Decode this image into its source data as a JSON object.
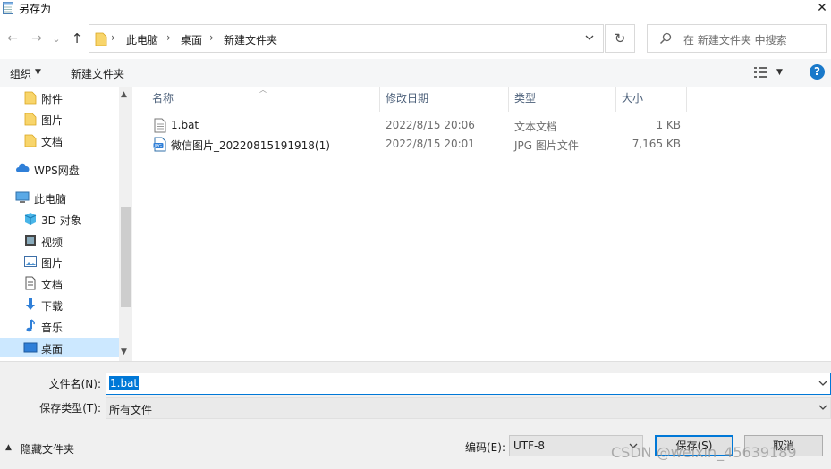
{
  "window": {
    "title": "另存为",
    "close_glyph": "✕"
  },
  "nav": {
    "back_glyph": "←",
    "forward_glyph": "→",
    "recent_glyph": "⌄",
    "up_glyph": "↑",
    "breadcrumbs": [
      "此电脑",
      "桌面",
      "新建文件夹"
    ],
    "crumb_separator": "›",
    "refresh_glyph": "↻",
    "search_placeholder": "在 新建文件夹 中搜索"
  },
  "toolbar": {
    "organize_label": "组织",
    "new_folder_label": "新建文件夹",
    "help_glyph": "?"
  },
  "sidebar": {
    "items": [
      {
        "label": "附件",
        "icon": "folder-icon"
      },
      {
        "label": "图片",
        "icon": "folder-icon"
      },
      {
        "label": "文档",
        "icon": "folder-icon"
      },
      {
        "label": "WPS网盘",
        "icon": "cloud-icon"
      },
      {
        "label": "此电脑",
        "icon": "computer-icon"
      },
      {
        "label": "3D 对象",
        "icon": "cube-icon"
      },
      {
        "label": "视频",
        "icon": "video-icon"
      },
      {
        "label": "图片",
        "icon": "picture-icon"
      },
      {
        "label": "文档",
        "icon": "document-icon"
      },
      {
        "label": "下载",
        "icon": "download-icon"
      },
      {
        "label": "音乐",
        "icon": "music-icon"
      },
      {
        "label": "桌面",
        "icon": "desktop-icon",
        "selected": true
      }
    ]
  },
  "filelist": {
    "columns": [
      "名称",
      "修改日期",
      "类型",
      "大小"
    ],
    "rows": [
      {
        "name": "1.bat",
        "date": "2022/8/15 20:06",
        "type": "文本文档",
        "size": "1 KB",
        "icon": "text-file-icon"
      },
      {
        "name": "微信图片_20220815191918(1)",
        "date": "2022/8/15 20:01",
        "type": "JPG 图片文件",
        "size": "7,165 KB",
        "icon": "jpg-file-icon"
      }
    ]
  },
  "bottom": {
    "filename_label": "文件名(N):",
    "filename_value": "1.bat",
    "filetype_label": "保存类型(T):",
    "filetype_value": "所有文件",
    "hide_folders_label": "隐藏文件夹",
    "encoding_label": "编码(E):",
    "encoding_value": "UTF-8",
    "save_label": "保存(S)",
    "cancel_label": "取消"
  },
  "watermark": "CSDN @weixin_45639189",
  "colors": {
    "accent": "#0078d7",
    "selection": "#cce8ff",
    "folder": "#f8d56b"
  }
}
